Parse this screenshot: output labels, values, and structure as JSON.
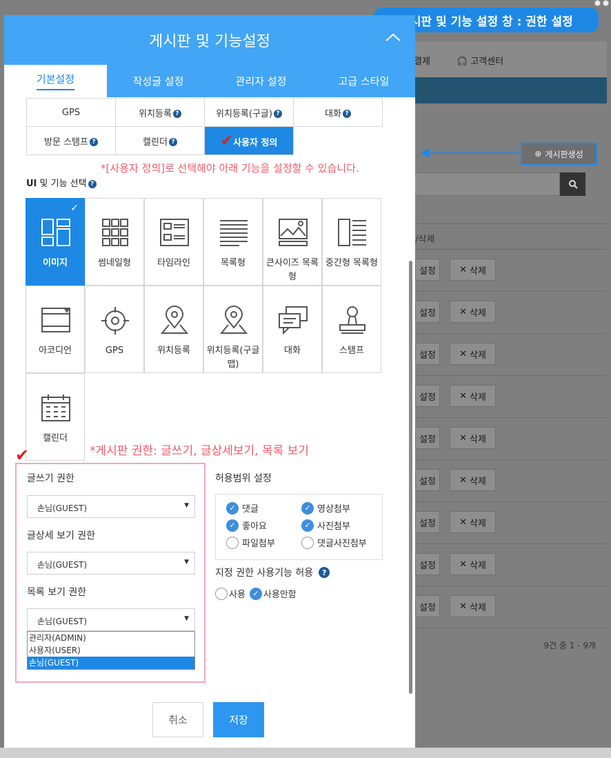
{
  "annotation": {
    "top_label": "게시판 및 기능 설정 창 : 권한 설정",
    "note_custom": "*[사용자 정의]로 선택해야 아래 기능을 설정할 수 있습니다.",
    "note_permissions": "*게시판 권한: 글쓰기, 글상세보기, 목록 보기",
    "callout_color": "#1e88e5",
    "note_color": "#f05a6a"
  },
  "background": {
    "nav_payment": "결제",
    "nav_support": "고객센터",
    "create_board": "게시판생성",
    "col_header": "/삭제",
    "row_setting": "설정",
    "row_delete": "삭제",
    "count": "9건 중 1 - 9개"
  },
  "dialog": {
    "title": "게시판 및 기능설정",
    "tabs": [
      "기본설정",
      "작성글 설정",
      "관리자 설정",
      "고급 스타일"
    ],
    "feature_table": [
      [
        "GPS",
        "위치등록",
        "위치등록(구글)",
        "대화"
      ],
      [
        "방문 스탬프",
        "캘린더",
        "사용자 정의"
      ]
    ],
    "ui_section_title": "UI",
    "ui_section_title_rest": " 및 기능 선택",
    "ui_tiles": [
      {
        "label": "이미지",
        "icon": "image-grid-icon",
        "selected": true
      },
      {
        "label": "썸네일형",
        "icon": "thumbnail-grid-icon"
      },
      {
        "label": "타임라인",
        "icon": "timeline-icon"
      },
      {
        "label": "목록형",
        "icon": "list-icon"
      },
      {
        "label": "큰사이즈 목록형",
        "icon": "large-list-icon"
      },
      {
        "label": "중간형 목록형",
        "icon": "medium-list-icon"
      },
      {
        "label": "아코디언",
        "icon": "accordion-icon"
      },
      {
        "label": "GPS",
        "icon": "crosshair-icon"
      },
      {
        "label": "위치등록",
        "icon": "map-pin-icon"
      },
      {
        "label": "위치등록(구글맵)",
        "icon": "map-pin-google-icon"
      },
      {
        "label": "대화",
        "icon": "chat-icon"
      },
      {
        "label": "스탬프",
        "icon": "stamp-icon"
      },
      {
        "label": "캘린더",
        "icon": "calendar-icon"
      }
    ],
    "write_permission": {
      "label": "글쓰기 권한",
      "value": "손님(GUEST)"
    },
    "detail_permission": {
      "label": "글상세 보기 권한",
      "value": "손님(GUEST)"
    },
    "list_permission": {
      "label": "목록 보기 권한",
      "value": "손님(GUEST)"
    },
    "dropdown_options": [
      "관리자(ADMIN)",
      "사용자(USER)",
      "손님(GUEST)"
    ],
    "scope": {
      "title": "허용범위 설정",
      "items": [
        {
          "label": "댓글",
          "checked": true
        },
        {
          "label": "영상첨부",
          "checked": true
        },
        {
          "label": "좋아요",
          "checked": true
        },
        {
          "label": "사진첨부",
          "checked": true
        },
        {
          "label": "파일첨부",
          "checked": false
        },
        {
          "label": "댓글사진첨부",
          "checked": false
        }
      ]
    },
    "assign": {
      "title": "지정 권한 사용기능 허용",
      "use": "사용",
      "not_use": "사용안함",
      "selected": "사용안함"
    },
    "cancel": "취소",
    "save": "저장",
    "accent_color": "#1e88e5"
  }
}
